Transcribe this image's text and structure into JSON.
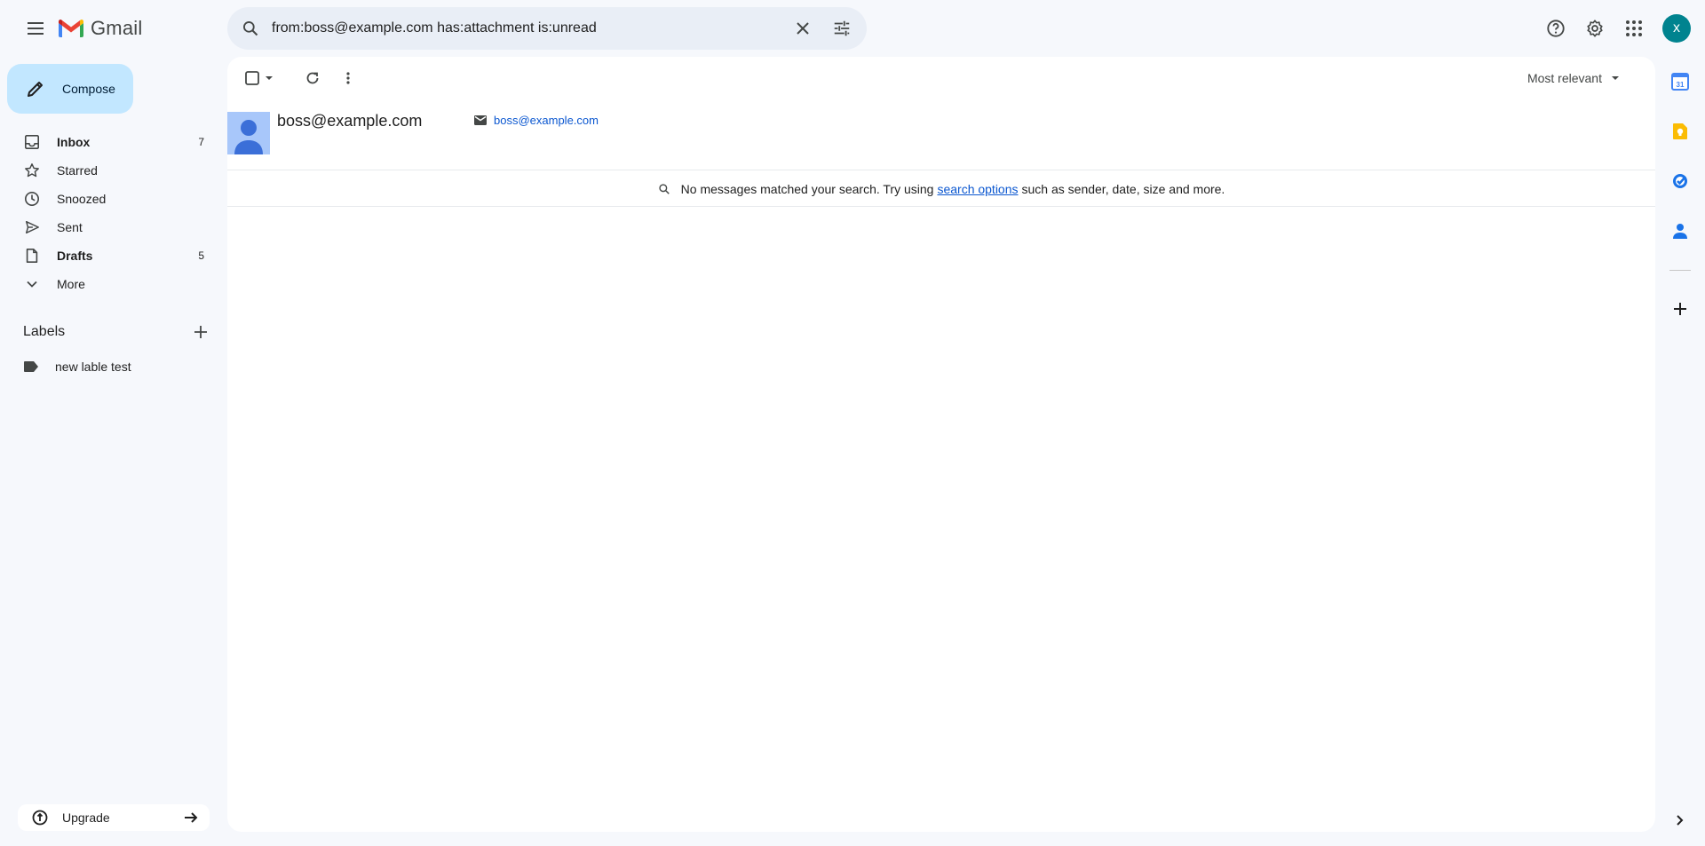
{
  "app": {
    "name": "Gmail"
  },
  "search": {
    "value": "from:boss@example.com has:attachment is:unread",
    "placeholder": "Search mail"
  },
  "header": {
    "avatar_letter": "x"
  },
  "compose": {
    "label": "Compose"
  },
  "nav": {
    "items": [
      {
        "label": "Inbox",
        "count": "7"
      },
      {
        "label": "Starred",
        "count": ""
      },
      {
        "label": "Snoozed",
        "count": ""
      },
      {
        "label": "Sent",
        "count": ""
      },
      {
        "label": "Drafts",
        "count": "5"
      },
      {
        "label": "More",
        "count": ""
      }
    ]
  },
  "labels": {
    "title": "Labels",
    "items": [
      {
        "label": "new lable test"
      }
    ]
  },
  "upgrade": {
    "label": "Upgrade"
  },
  "toolbar": {
    "sort_label": "Most relevant"
  },
  "contact": {
    "name": "boss@example.com",
    "email": "boss@example.com"
  },
  "results": {
    "prefix": "No messages matched your search. Try using",
    "link": "search options",
    "suffix": "such as sender, date, size and more."
  },
  "colors": {
    "accent": "#0b57d0",
    "compose_bg": "#c2e7ff",
    "avatar_bg": "#00838f",
    "page_bg": "#f6f8fc"
  }
}
